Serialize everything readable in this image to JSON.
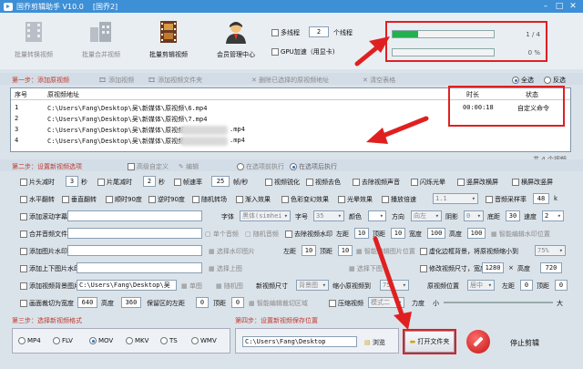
{
  "window": {
    "title": "国乔剪辑助手 V10.0",
    "subtitle": "[国乔2]",
    "controls": [
      "–",
      "□",
      "✕"
    ]
  },
  "toolbar": {
    "tools": [
      {
        "label": "批量转换视频",
        "icon": "film-convert-icon",
        "enabled": false
      },
      {
        "label": "批量合并视频",
        "icon": "building-merge-icon",
        "enabled": false
      },
      {
        "label": "批量剪辑视频",
        "icon": "film-strip-icon",
        "enabled": true
      },
      {
        "label": "会员管理中心",
        "icon": "user-center-icon",
        "enabled": true
      }
    ],
    "multithread_label": "多线程",
    "thread_count": "2",
    "thread_unit": "个线程",
    "gpu_label": "GPU加速（用显卡)",
    "progress": [
      {
        "value": 0.25,
        "text": "1 / 4"
      },
      {
        "value": 0,
        "text": "0 %"
      }
    ]
  },
  "step1": {
    "title": "第一步：添加原视频",
    "buttons": [
      "添加视频",
      "添加视频文件夹",
      "删除已选择的原视频地址",
      "清空表格"
    ],
    "select_all": "全选",
    "invert": "反选"
  },
  "table": {
    "headers": [
      "序号",
      "原视频地址",
      "时长",
      "状态"
    ],
    "rows": [
      {
        "index": "1",
        "path": "C:\\Users\\Fang\\Desktop\\吴\\新媒体\\原视频\\6.mp4",
        "duration": "00:00:18",
        "status": "自定义命令"
      },
      {
        "index": "2",
        "path": "C:\\Users\\Fang\\Desktop\\吴\\新媒体\\原视频\\7.mp4",
        "duration": "",
        "status": ""
      },
      {
        "index": "3",
        "path": "C:\\Users\\Fang\\Desktop\\吴\\新媒体\\原视频\\",
        "suffix": ".mp4",
        "duration": "",
        "status": ""
      },
      {
        "index": "4",
        "path": "C:\\Users\\Fang\\Desktop\\吴\\新媒体\\原视频\\",
        "suffix": ".mp4",
        "duration": "",
        "status": ""
      }
    ],
    "total": "共 4 个视频"
  },
  "step2": {
    "title": "第二步：设置新视频选项",
    "mode": {
      "advanced": "高级自定义",
      "edit": "编辑",
      "before": "在选项前执行",
      "after": "在选项后执行"
    },
    "row1": {
      "head_cut": "片头减时",
      "head_val": "3",
      "sec1": "秒",
      "tail_cut": "片尾减时",
      "tail_val": "2",
      "sec2": "秒",
      "fps": "帧速率",
      "fps_val": "25",
      "fps_unit": "帧/秒",
      "opts": [
        "视频锐化",
        "视频去色",
        "去除视频声音",
        "闪烁光晕",
        "竖屏改横屏",
        "横屏改竖屏"
      ]
    },
    "row2": {
      "opts": [
        "水平翻转",
        "垂直翻转",
        "顺时90度",
        "逆时90度",
        "随机转场",
        "渐入效果",
        "色彩变幻效果",
        "光晕效果",
        "播放倍速"
      ],
      "speed_val": "1.1",
      "sample_rate": "音频采样率",
      "sample_val": "48",
      "sample_unit": "k"
    },
    "row3": {
      "subtitle": "添加滚动字幕",
      "font": "字体",
      "font_val": "黑体(simhei",
      "size": "字号",
      "size_val": "35",
      "color": "颜色",
      "dir": "方向",
      "dir_val": "向左",
      "shadow": "阴影",
      "shadow_val": "0",
      "bottom": "底距",
      "bottom_val": "30",
      "speed": "速度",
      "speed_val": "2"
    },
    "row4": {
      "audio": "合并音频文件",
      "single": "单个音频",
      "random": "随机音频",
      "remove_wm": "去除视频水印",
      "left": "左距",
      "left_val": "10",
      "top": "顶距",
      "top_val": "10",
      "width": "宽度",
      "width_val": "100",
      "height": "高度",
      "height_val": "100",
      "smart": "智能编辑水印位置"
    },
    "row5": {
      "img_wm": "添加图片水印",
      "choose": "选择水印图片",
      "left": "左距",
      "left_val": "10",
      "top": "顶距",
      "top_val": "10",
      "smart": "智能编辑图片位置",
      "blur_bg": "虚化边框背景，将原视频缩小到",
      "blur_val": "75%"
    },
    "row6": {
      "tb_wm": "添加上下图片水印",
      "top_img": "选择上图",
      "bottom_img": "选择下图",
      "resize": "修改视频尺寸，宽度",
      "w_val": "1280",
      "x": "×",
      "height": "高度",
      "h_val": "720"
    },
    "row7": {
      "bg_img": "添加视频背景图片",
      "bg_path": "C:\\Users\\Fang\\Desktop\\吴",
      "single": "单图",
      "random": "随机图",
      "new_size": "新视频尺寸",
      "size_val": "背景图",
      "scale": "缩小原视频到",
      "scale_val": "75%",
      "pos": "原视频位置",
      "pos_val": "居中",
      "left": "左距",
      "left_val": "0",
      "top": "顶距",
      "top_val": "0"
    },
    "row8": {
      "crop": "画面裁切为宽度",
      "w_val": "640",
      "height": "高度",
      "h_val": "360",
      "keep": "保留区的左距",
      "left_val": "0",
      "top": "顶距",
      "top_val": "0",
      "smart": "智能编辑裁切区域",
      "compress": "压缩视频",
      "compress_val": "模式二",
      "power": "力度",
      "small": "小",
      "big": "大"
    }
  },
  "step3": {
    "title": "第三步：选择新视频格式",
    "formats": [
      "MP4",
      "FLV",
      "MOV",
      "MKV",
      "TS",
      "WMV"
    ],
    "selected": "MOV"
  },
  "step4": {
    "title": "第四步：设置新视频保存位置",
    "path": "C:\\Users\\Fang\\Desktop",
    "browse": "浏览",
    "open": "打开文件夹",
    "stop": "停止剪辑"
  },
  "colors": {
    "accent": "#3d8fd6",
    "highlight": "#e02020",
    "progress": "#22b14c"
  }
}
